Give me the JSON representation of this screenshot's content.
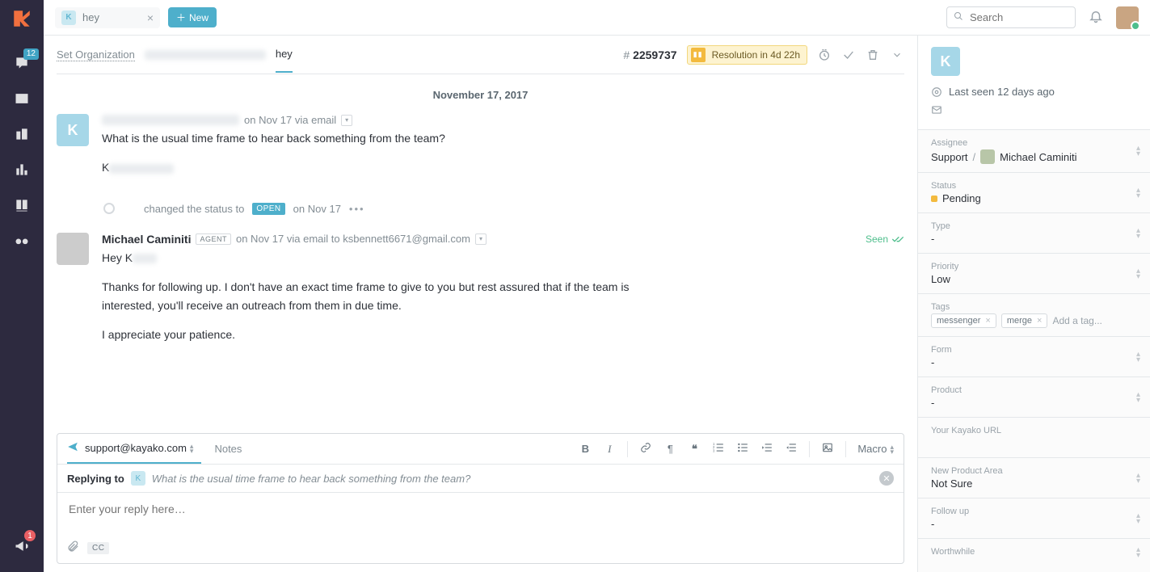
{
  "sidebar": {
    "inbox_count": "12",
    "announce_count": "1"
  },
  "topbar": {
    "tab_avatar_initial": "K",
    "tab_label": "hey",
    "new_button": "New",
    "search_placeholder": "Search"
  },
  "breadcrumb": {
    "set_org": "Set Organization",
    "subject": "hey",
    "case_prefix": "#",
    "case_id": "2259737",
    "resolution_text": "Resolution in 4d 22h"
  },
  "conversation": {
    "date_separator": "November 17, 2017",
    "msg1": {
      "avatar_initial": "K",
      "meta_time": "on Nov 17 via email",
      "line1": "What is the usual time frame to hear back something from the team?",
      "sig_initial": "K"
    },
    "status_change": {
      "text_prefix": "changed the status to",
      "badge": "OPEN",
      "time": "on Nov 17"
    },
    "msg2": {
      "name": "Michael Caminiti",
      "agent_badge": "AGENT",
      "meta_time": "on Nov 17 via email to ksbennett6671@gmail.com",
      "seen_label": "Seen",
      "line1": "Hey K",
      "line2": "Thanks for following up. I don't have an exact time frame to give to you but rest assured that if the team is interested, you'll receive an outreach from them in due time.",
      "line3": "I appreciate your patience."
    }
  },
  "reply": {
    "from_address": "support@kayako.com",
    "notes_tab": "Notes",
    "macro_label": "Macro",
    "context_label": "Replying to",
    "context_avatar_initial": "K",
    "context_quoted": "What is the usual time frame to hear back something from the team?",
    "placeholder": "Enter your reply here…",
    "cc_label": "CC"
  },
  "right": {
    "avatar_initial": "K",
    "last_seen": "Last seen 12 days ago",
    "assignee_label": "Assignee",
    "assignee_team": "Support",
    "assignee_sep": "/",
    "assignee_name": "Michael Caminiti",
    "status_label": "Status",
    "status_value": "Pending",
    "type_label": "Type",
    "type_value": "-",
    "priority_label": "Priority",
    "priority_value": "Low",
    "tags_label": "Tags",
    "tag1": "messenger",
    "tag2": "merge",
    "add_tag_placeholder": "Add a tag...",
    "form_label": "Form",
    "form_value": "-",
    "product_label": "Product",
    "product_value": "-",
    "url_label": "Your Kayako URL",
    "npa_label": "New Product Area",
    "npa_value": "Not Sure",
    "followup_label": "Follow up",
    "followup_value": "-",
    "worthwhile_label": "Worthwhile"
  }
}
